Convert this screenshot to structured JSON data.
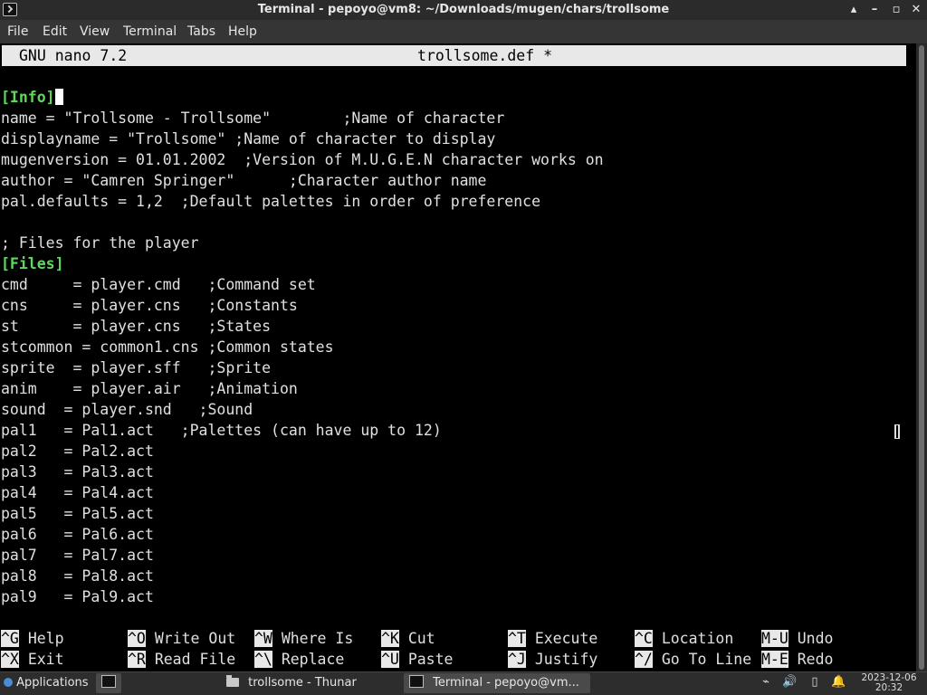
{
  "window": {
    "title": "Terminal - pepoyo@vm8: ~/Downloads/mugen/chars/trollsome",
    "controls": {
      "minimize": "▴",
      "restore": "–",
      "maximize": "▫",
      "close": "✕"
    }
  },
  "menu": [
    "File",
    "Edit",
    "View",
    "Terminal",
    "Tabs",
    "Help"
  ],
  "nano": {
    "version": "GNU nano 7.2",
    "filename": "trollsome.def *"
  },
  "editor": {
    "lines": [
      "",
      "[Info]",
      "name = \"Trollsome - Trollsome\"        ;Name of character",
      "displayname = \"Trollsome\" ;Name of character to display",
      "mugenversion = 01.01.2002  ;Version of M.U.G.E.N character works on",
      "author = \"Camren Springer\"      ;Character author name",
      "pal.defaults = 1,2  ;Default palettes in order of preference",
      "",
      "; Files for the player",
      "[Files]",
      "cmd     = player.cmd   ;Command set",
      "cns     = player.cns   ;Constants",
      "st      = player.cns   ;States",
      "stcommon = common1.cns ;Common states",
      "sprite  = player.sff   ;Sprite",
      "anim    = player.air   ;Animation",
      "sound  = player.snd   ;Sound",
      "pal1   = Pal1.act   ;Palettes (can have up to 12)",
      "pal2   = Pal2.act",
      "pal3   = Pal3.act",
      "pal4   = Pal4.act",
      "pal5   = Pal5.act",
      "pal6   = Pal6.act",
      "pal7   = Pal7.act",
      "pal8   = Pal8.act",
      "pal9   = Pal9.act"
    ]
  },
  "shortcuts": {
    "row1": [
      {
        "key": "^G",
        "label": "Help"
      },
      {
        "key": "^O",
        "label": "Write Out"
      },
      {
        "key": "^W",
        "label": "Where Is"
      },
      {
        "key": "^K",
        "label": "Cut"
      },
      {
        "key": "^T",
        "label": "Execute"
      },
      {
        "key": "^C",
        "label": "Location"
      },
      {
        "key": "M-U",
        "label": "Undo"
      }
    ],
    "row2": [
      {
        "key": "^X",
        "label": "Exit"
      },
      {
        "key": "^R",
        "label": "Read File"
      },
      {
        "key": "^\\",
        "label": "Replace"
      },
      {
        "key": "^U",
        "label": "Paste"
      },
      {
        "key": "^J",
        "label": "Justify"
      },
      {
        "key": "^/",
        "label": "Go To Line"
      },
      {
        "key": "M-E",
        "label": "Redo"
      }
    ]
  },
  "taskbar": {
    "applications": "Applications",
    "tasks": [
      "trollsome - Thunar",
      "Terminal - pepoyo@vm..."
    ],
    "clock": {
      "date": "2023-12-06",
      "time": "20:32"
    }
  },
  "colors": {
    "section_header": "#5fd75f",
    "shortcut_key_bg": "#e8e8e8",
    "terminal_bg": "#000000"
  }
}
